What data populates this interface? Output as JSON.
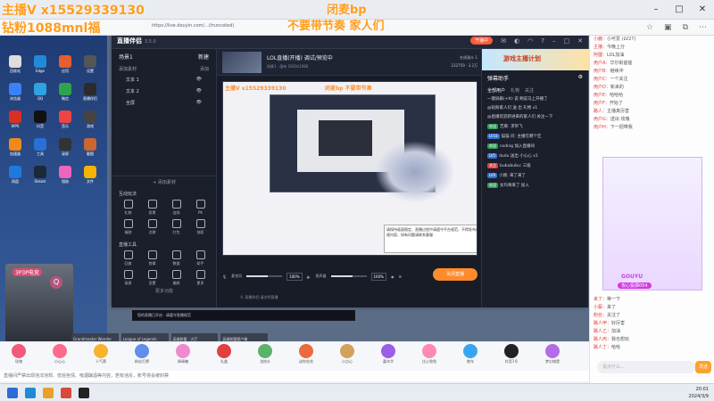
{
  "browser": {
    "url": "https://live.douyin.com/...(truncated)",
    "icons": [
      "star-icon",
      "collections-icon",
      "extensions-icon",
      "menu-icon"
    ]
  },
  "stream_overlay": {
    "line1": "主播V x15529339130",
    "line2": "钻粉1088mnl福",
    "right1": "闭麦bp",
    "right2": "不要带节奏 家人们"
  },
  "desktop": {
    "icons": [
      {
        "label": "回收站",
        "color": "#ddd"
      },
      {
        "label": "Edge",
        "color": "#1f8ad8"
      },
      {
        "label": "应用",
        "color": "#e85d2e"
      },
      {
        "label": "设置",
        "color": "#555"
      },
      {
        "label": "浏览器",
        "color": "#3b82f6"
      },
      {
        "label": "QQ",
        "color": "#2da3e0"
      },
      {
        "label": "微信",
        "color": "#2ea44f"
      },
      {
        "label": "直播伴侣",
        "color": "#2b2b2b"
      },
      {
        "label": "WPS",
        "color": "#d93025"
      },
      {
        "label": "抖音",
        "color": "#111"
      },
      {
        "label": "音乐",
        "color": "#e44"
      },
      {
        "label": "游戏",
        "color": "#444"
      },
      {
        "label": "加速器",
        "color": "#ee8a1a"
      },
      {
        "label": "工具",
        "color": "#2a6fd6"
      },
      {
        "label": "录屏",
        "color": "#333"
      },
      {
        "label": "截图",
        "color": "#c63"
      },
      {
        "label": "网盘",
        "color": "#1f7ae0"
      },
      {
        "label": "Steam",
        "color": "#1b2838"
      },
      {
        "label": "相册",
        "color": "#e6b"
      },
      {
        "label": "文件",
        "color": "#f5b400"
      }
    ],
    "avatar_label": "3P3P电竞",
    "search_glyph": "Q"
  },
  "app": {
    "title": "直播伴侣",
    "version": "3.5.0",
    "start_live_label": "开播中",
    "top_icons": [
      "mail-icon",
      "skin-icon",
      "headset-icon",
      "help-icon",
      "minimize-icon",
      "maximize-icon",
      "close-icon"
    ],
    "scene": {
      "title": "场景1",
      "add": "新建"
    },
    "sources_head": {
      "title": "添加素材",
      "action": "添加"
    },
    "sources": [
      {
        "label": "文本 1"
      },
      {
        "label": "文本 2"
      },
      {
        "label": "全屏"
      }
    ],
    "add_source_label": "+ 添加素材",
    "interaction_title": "互动玩法",
    "interaction_tools": [
      {
        "label": "礼物"
      },
      {
        "label": "投票"
      },
      {
        "label": "连线"
      },
      {
        "label": "PK"
      },
      {
        "label": "福袋"
      },
      {
        "label": "点歌"
      },
      {
        "label": "红包"
      },
      {
        "label": "抽奖"
      }
    ],
    "tools_title": "直播工具",
    "live_tools": [
      {
        "label": "回放"
      },
      {
        "label": "剪辑"
      },
      {
        "label": "数据"
      },
      {
        "label": "助手"
      },
      {
        "label": "录屏"
      },
      {
        "label": "设置"
      },
      {
        "label": "美颜"
      },
      {
        "label": "更多"
      }
    ],
    "more_functions": "更多功能",
    "preview": {
      "title": "LOL直播(开播) 调试/预览中",
      "subtitle": "场景1 · 画布 1920x1080",
      "stat_online": "在线观众 1",
      "stat_likes": "232759",
      "stat_comments": "3.2万"
    },
    "canvas_overlay_left": "主播V x15529339130",
    "canvas_overlay_right": "闭麦bp 不要带节奏",
    "tooltip_text": "请保持画面稳定，直播过程中请遵守平台规范，不得发布违规内容，如有问题请联系客服",
    "mixer": {
      "mic_label": "麦克风",
      "mic_pct": "100%",
      "speaker_label": "扬声器",
      "speaker_pct": "100%",
      "mic_level": 0.6,
      "speaker_level": 0.6,
      "icons": [
        "mic-icon",
        "speaker-icon",
        "camera-icon",
        "settings-icon"
      ]
    },
    "go_live_label": "关闭直播",
    "low_message": "© 直播伴侣·请文明直播",
    "right_panel": {
      "banner": "游戏主播计划",
      "title": "弹幕助手",
      "tabs": [
        "全部用户",
        "礼物",
        "关注"
      ],
      "messages": [
        {
          "badge": "",
          "badge_color": "",
          "text": "一键屏蔽(+tt) 说 啊说马上开播了"
        },
        {
          "badge": "",
          "badge_color": "",
          "text": "@钻粉家人们 送 出 礼物 x1"
        },
        {
          "badge": "",
          "badge_color": "",
          "text": "@直播欢迎新进来的家人们 关注一下"
        },
        {
          "badge": "欢迎",
          "badge_color": "#2e9a58",
          "text": "芝麻: 求带飞"
        },
        {
          "badge": "LV18",
          "badge_color": "#356fd0",
          "text": "猫猫 问: 主播在哪个区"
        },
        {
          "badge": "欢迎",
          "badge_color": "#2e9a58",
          "text": "coding 加入直播间"
        },
        {
          "badge": "LV5",
          "badge_color": "#356fd0",
          "text": "dudu 送出 小心心 x1"
        },
        {
          "badge": "关注",
          "badge_color": "#e0413c",
          "text": "bubububu: 三级"
        },
        {
          "badge": "LV9",
          "badge_color": "#356fd0",
          "text": "小刚: 来了来了"
        },
        {
          "badge": "欢迎",
          "badge_color": "#2e9a58",
          "text": "女玛将来了 加入"
        }
      ]
    }
  },
  "game_strip": [
    "Grandmaster Wonder",
    "League of Legends",
    "英雄联盟 · 大厅",
    "英雄联盟客户端"
  ],
  "stage_footer": "您的直播已开启 · 请遵守直播规范",
  "gifts": [
    {
      "label": "玫瑰",
      "color": "#f25a7a"
    },
    {
      "label": "小心心",
      "color": "#ff6b8a"
    },
    {
      "label": "人气票",
      "color": "#f7b42c"
    },
    {
      "label": "粉丝灯牌",
      "color": "#5f8fe6"
    },
    {
      "label": "棒棒糖",
      "color": "#f08ad0"
    },
    {
      "label": "礼盒",
      "color": "#e0413c"
    },
    {
      "label": "龙抬头",
      "color": "#5ab36a"
    },
    {
      "label": "送你花花",
      "color": "#ec6b3d"
    },
    {
      "label": "小点心",
      "color": "#d5a05a"
    },
    {
      "label": "嘉年华",
      "color": "#9a5fe6"
    },
    {
      "label": "比心兔兔",
      "color": "#ff8ab0"
    },
    {
      "label": "跑车",
      "color": "#3aa5ef"
    },
    {
      "label": "抖音1号",
      "color": "#222"
    },
    {
      "label": "梦幻城堡",
      "color": "#b56be8"
    }
  ],
  "notice": "直播间严禁出现违法违规、低俗色情、吸烟酗酒等内容，若有违反，账号将会被封禁",
  "sidebar": {
    "lines": [
      {
        "user": "小鹿",
        "text": "小可爱 (LV27)"
      },
      {
        "user": "主播",
        "text": "今晚上分"
      },
      {
        "user": "阿狸",
        "text": "LOL加油"
      },
      {
        "user": "用户A",
        "text": "华尔街爸爸"
      },
      {
        "user": "用户B",
        "text": "继续冲"
      },
      {
        "user": "用户C",
        "text": "一个关注"
      },
      {
        "user": "用户D",
        "text": "新来的"
      },
      {
        "user": "用户E",
        "text": "哈哈哈"
      },
      {
        "user": "用户F",
        "text": "开始了"
      },
      {
        "user": "路人",
        "text": "主播真厉害"
      },
      {
        "user": "用户G",
        "text": "送出 玫瑰"
      },
      {
        "user": "用户H",
        "text": "下一把带我"
      }
    ],
    "lines_bottom": [
      {
        "user": "来了",
        "text": "等一下"
      },
      {
        "user": "小蔡",
        "text": "来了"
      },
      {
        "user": "粉丝",
        "text": "关注了"
      },
      {
        "user": "路人甲",
        "text": "好厉害"
      },
      {
        "user": "路人乙",
        "text": "加油"
      },
      {
        "user": "路人丙",
        "text": "我也想玩"
      },
      {
        "user": "路人丁",
        "text": "哈哈"
      }
    ],
    "card_name": "GOUYU",
    "card_sub": "攻心投掷054",
    "input_placeholder": "说点什么...",
    "send_label": "发送"
  },
  "taskbar": {
    "time": "20:01",
    "date": "2024/3/9"
  }
}
